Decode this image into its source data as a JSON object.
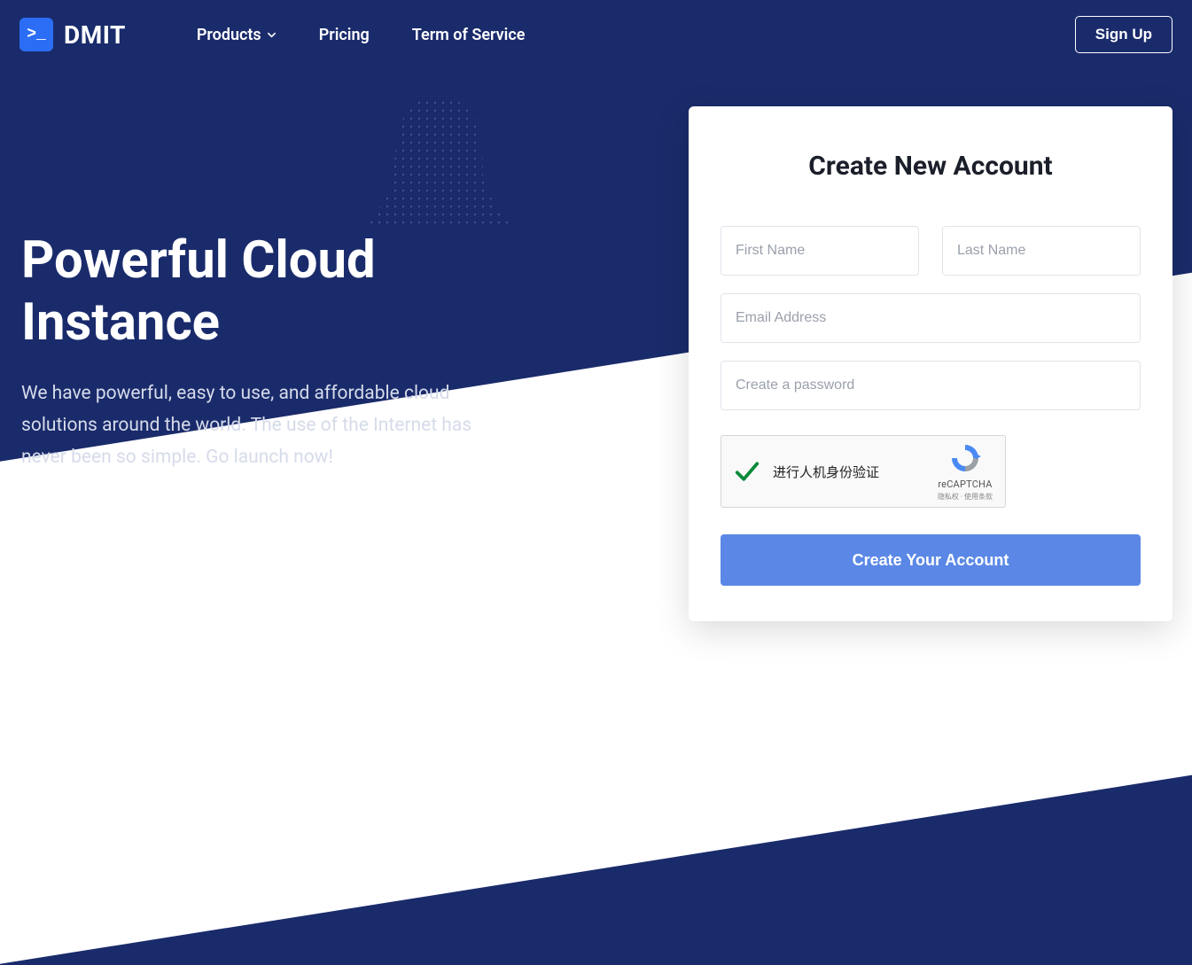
{
  "brand": {
    "name": "DMIT",
    "logo_glyph": ">_"
  },
  "nav": {
    "items": [
      {
        "label": "Products",
        "has_dropdown": true
      },
      {
        "label": "Pricing",
        "has_dropdown": false
      },
      {
        "label": "Term of Service",
        "has_dropdown": false
      }
    ],
    "signup_label": "Sign Up"
  },
  "hero": {
    "heading": "Powerful Cloud Instance",
    "subtext": "We have powerful, easy to use, and affordable cloud solutions around the world. The use of the Internet has never been so simple. Go launch now!"
  },
  "signup_form": {
    "title": "Create New Account",
    "first_name_placeholder": "First Name",
    "last_name_placeholder": "Last Name",
    "email_placeholder": "Email Address",
    "password_placeholder": "Create a password",
    "recaptcha_label": "进行人机身份验证",
    "recaptcha_brand": "reCAPTCHA",
    "recaptcha_terms": "隐私权 · 使用条款",
    "submit_label": "Create Your Account"
  }
}
